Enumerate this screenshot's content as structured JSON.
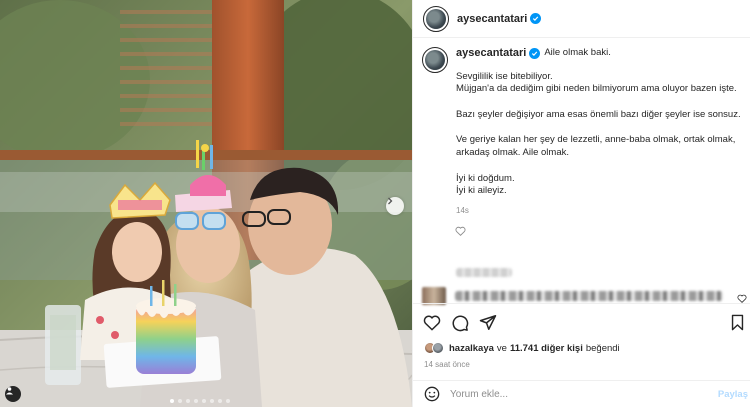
{
  "post": {
    "username": "aysecantatari",
    "verified": true,
    "caption_first": "Aile olmak baki.",
    "caption_paragraphs": [
      "Sevgililik ise bitebiliyor.\nMüjgan'a da dediğim gibi neden bilmiyorum ama oluyor bazen işte.",
      "Bazı şeyler değişiyor ama esas önemli bazı diğer şeyler ise sonsuz.",
      "Ve geriye kalan her şey de lezzetli, anne-baba olmak, ortak olmak, arkadaş olmak. Aile olmak.",
      "İyi ki doğdum.\nİyi ki aileyiz."
    ],
    "caption_time": "14s",
    "likes_user": "hazalkaya",
    "likes_connector": "ve",
    "likes_rest": "11.741 diğer kişi",
    "likes_suffix": "beğendi",
    "time_ago": "14 saat önce"
  },
  "comment": {
    "placeholder": "Yorum ekle...",
    "post_label": "Paylaş"
  },
  "carousel": {
    "slides": 8,
    "active": 0
  },
  "colors": {
    "accent": "#0095f6",
    "post_disabled": "#b3dbff",
    "muted": "#8e8e8e"
  },
  "icons": [
    "heart-icon",
    "comment-icon",
    "share-icon",
    "bookmark-icon",
    "emoji-icon",
    "chevron-right-icon",
    "user-tag-icon",
    "verified-icon"
  ]
}
